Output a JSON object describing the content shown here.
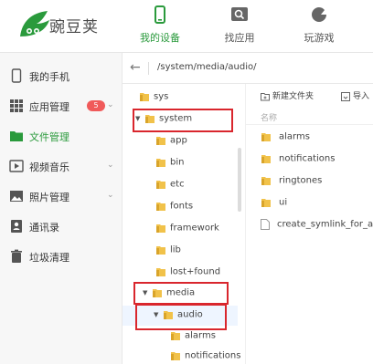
{
  "app": {
    "name": "豌豆荚"
  },
  "nav": [
    {
      "label": "我的设备",
      "icon": "phone-icon",
      "active": true
    },
    {
      "label": "找应用",
      "icon": "app-store-icon",
      "active": false
    },
    {
      "label": "玩游戏",
      "icon": "game-icon",
      "active": false
    }
  ],
  "sidebar": {
    "items": [
      {
        "label": "我的手机",
        "icon": "phone-icon"
      },
      {
        "label": "应用管理",
        "icon": "grid-icon",
        "badge": "5"
      },
      {
        "label": "文件管理",
        "icon": "folder-icon",
        "active": true
      },
      {
        "label": "视频音乐",
        "icon": "media-icon"
      },
      {
        "label": "照片管理",
        "icon": "photo-icon"
      },
      {
        "label": "通讯录",
        "icon": "contacts-icon"
      },
      {
        "label": "垃圾清理",
        "icon": "trash-icon"
      }
    ]
  },
  "address": {
    "path": "/system/media/audio/"
  },
  "tree": {
    "nodes": [
      {
        "label": "sys",
        "expanded": null,
        "depth": 1
      },
      {
        "label": "system",
        "expanded": true,
        "depth": 0
      },
      {
        "label": "app",
        "expanded": null,
        "depth": 1
      },
      {
        "label": "bin",
        "expanded": null,
        "depth": 1
      },
      {
        "label": "etc",
        "expanded": null,
        "depth": 1
      },
      {
        "label": "fonts",
        "expanded": null,
        "depth": 1
      },
      {
        "label": "framework",
        "expanded": null,
        "depth": 1
      },
      {
        "label": "lib",
        "expanded": null,
        "depth": 1
      },
      {
        "label": "lost+found",
        "expanded": null,
        "depth": 1
      },
      {
        "label": "media",
        "expanded": true,
        "depth": 0
      },
      {
        "label": "audio",
        "expanded": true,
        "depth": 1,
        "selected": true
      },
      {
        "label": "alarms",
        "expanded": null,
        "depth": 2
      },
      {
        "label": "notifications",
        "expanded": null,
        "depth": 2
      }
    ]
  },
  "panel": {
    "toolbar": {
      "new_folder": "新建文件夹",
      "import": "导入"
    },
    "column_name": "名称",
    "files": [
      {
        "name": "alarms",
        "type": "folder"
      },
      {
        "name": "notifications",
        "type": "folder"
      },
      {
        "name": "ringtones",
        "type": "folder"
      },
      {
        "name": "ui",
        "type": "folder"
      },
      {
        "name": "create_symlink_for_aud",
        "type": "file"
      }
    ]
  },
  "colors": {
    "accent": "#2a9a3c",
    "badge": "#f05a5a",
    "highlight": "#d9262d",
    "folder": "#f1c24a"
  }
}
